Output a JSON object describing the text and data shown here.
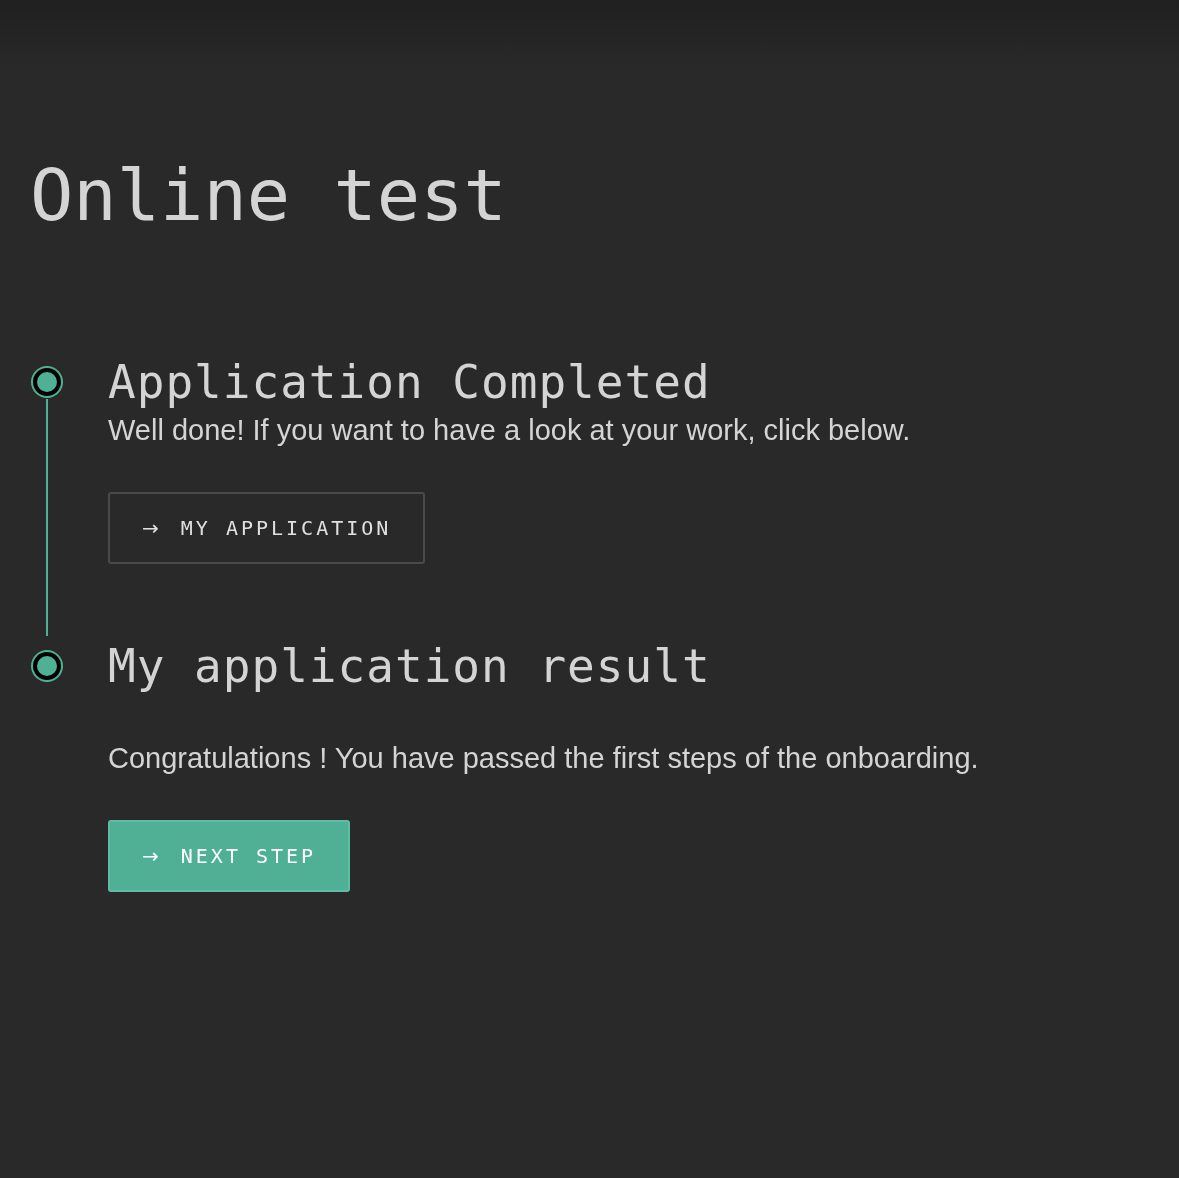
{
  "title": "Online test",
  "steps": [
    {
      "heading": "Application Completed",
      "text": "Well done! If you want to have a look at your work, click below.",
      "button": {
        "kind": "outline",
        "arrow": "→",
        "label": "MY APPLICATION"
      }
    },
    {
      "heading": "My application result",
      "text": "Congratulations ! You have passed the first steps of the onboarding.",
      "button": {
        "kind": "primary",
        "arrow": "→",
        "label": "NEXT STEP"
      }
    }
  ]
}
